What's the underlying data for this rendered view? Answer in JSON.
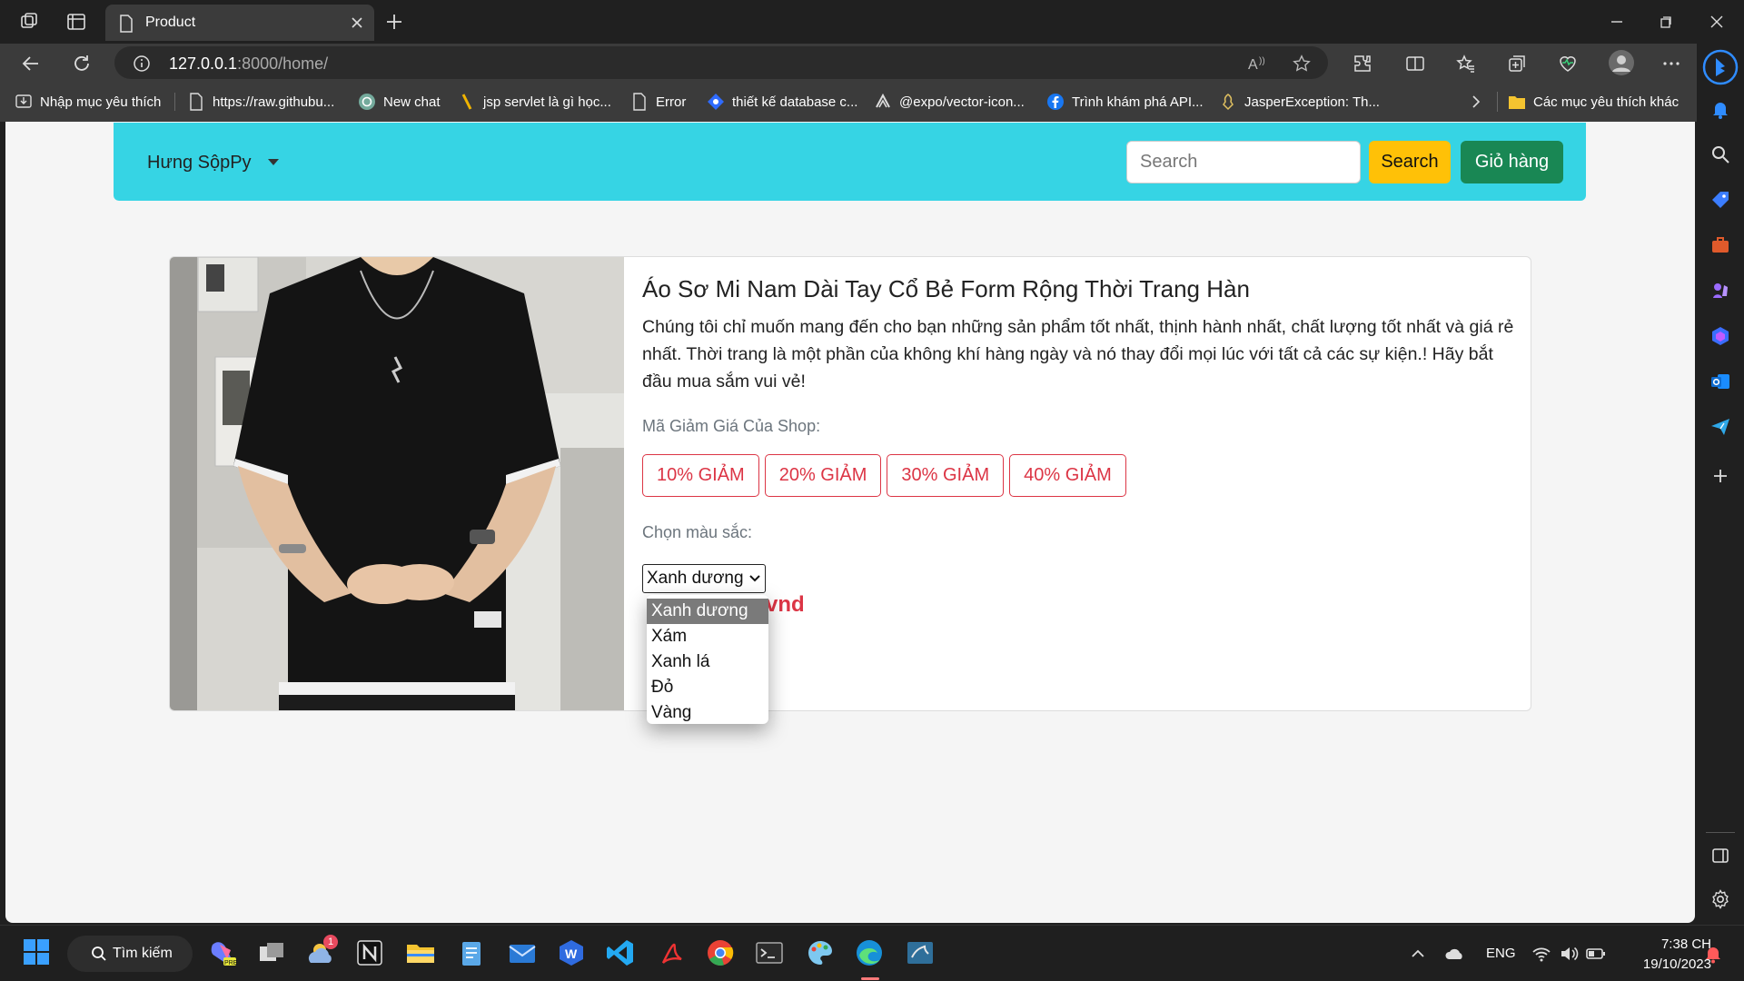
{
  "browser": {
    "tab_title": "Product",
    "url_host": "127.0.0.1",
    "url_path": ":8000/home/",
    "bookmarks": [
      "Nhập mục yêu thích",
      "https://raw.githubu...",
      "New chat",
      "jsp servlet là gì học...",
      "Error",
      "thiết kế database c...",
      "@expo/vector-icon...",
      "Trình khám phá API...",
      "JasperException: Th..."
    ],
    "other_bookmarks": "Các mục yêu thích khác"
  },
  "navbar": {
    "brand": "Hưng SộpPy",
    "search_placeholder": "Search",
    "search_button": "Search",
    "cart_button": "Giỏ hàng"
  },
  "product": {
    "title": "Áo Sơ Mi Nam Dài Tay Cổ Bẻ Form Rộng Thời Trang Hàn",
    "description": "Chúng tôi chỉ muốn mang đến cho bạn những sản phẩm tốt nhất, thịnh hành nhất, chất lượng tốt nhất và giá rẻ nhất. Thời trang là một phần của không khí hàng ngày và nó thay đổi mọi lúc với tất cả các sự kiện.! Hãy bắt đầu mua sắm vui vẻ!",
    "discount_label": "Mã Giảm Giá Của Shop:",
    "coupons": [
      "10% GIẢM",
      "20% GIẢM",
      "30% GIẢM",
      "40% GIẢM"
    ],
    "color_label": "Chọn màu sắc:",
    "selected_color": "Xanh dương",
    "color_options": [
      "Xanh dương",
      "Xám",
      "Xanh lá",
      "Đỏ",
      "Vàng"
    ],
    "price_suffix": "vnd"
  },
  "taskbar": {
    "search_label": "Tìm kiếm",
    "weather_badge": "1",
    "language": "ENG",
    "time": "7:38 CH",
    "date": "19/10/2023"
  }
}
